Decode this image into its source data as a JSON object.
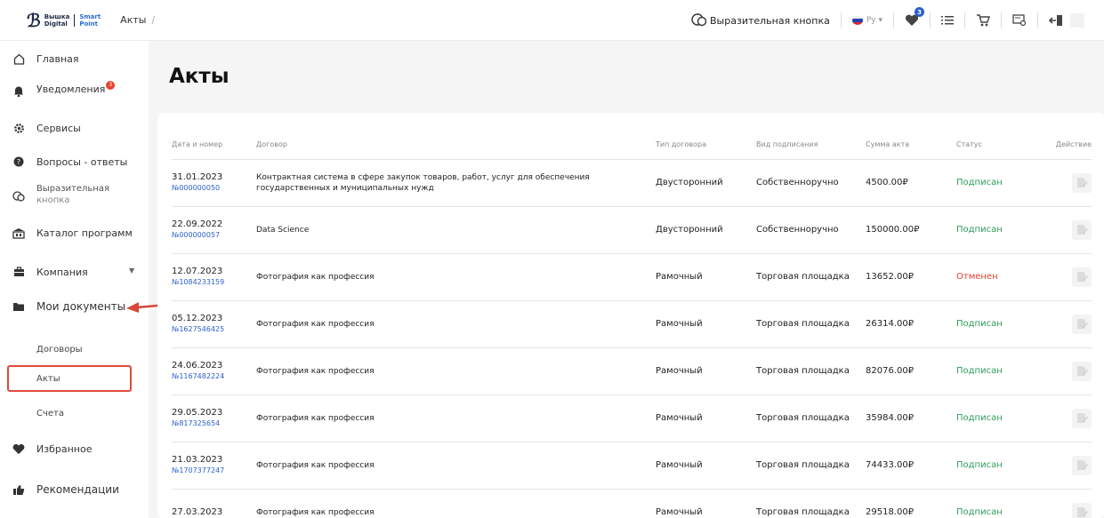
{
  "header": {
    "logo_line1": "Вышка",
    "logo_line2": "Digital",
    "logo_line3": "Smart",
    "logo_line4": "Point",
    "breadcrumb": "Акты",
    "breadcrumb_sep": "/",
    "expressive_button": "Выразительная кнопка",
    "lang": "Ру ▾",
    "favorites_count": "3"
  },
  "sidebar": {
    "items": [
      {
        "label": "Главная",
        "icon": "home-icon"
      },
      {
        "label": "Уведомления",
        "icon": "bell-icon",
        "badge": "3"
      },
      {
        "label": "Сервисы",
        "icon": "gear-icon"
      },
      {
        "label": "Вопросы - ответы",
        "icon": "help-icon"
      },
      {
        "label": "Выразительная",
        "label2": "кнопка",
        "icon": "expressive-icon"
      },
      {
        "label": "Каталог программ",
        "icon": "catalog-icon"
      },
      {
        "label": "Компания",
        "icon": "briefcase-icon"
      },
      {
        "label": "Мои документы",
        "icon": "folder-icon"
      },
      {
        "label": "Договоры"
      },
      {
        "label": "Акты"
      },
      {
        "label": "Счета"
      },
      {
        "label": "Избранное",
        "icon": "heart-icon"
      },
      {
        "label": "Рекомендации",
        "icon": "thumbs-up-icon"
      }
    ]
  },
  "main": {
    "title": "Акты",
    "columns": [
      "Дата и номер",
      "Договор",
      "Тип договора",
      "Вид подписания",
      "Сумма акта",
      "Статус",
      "Действие"
    ],
    "rows": [
      {
        "date": "31.01.2023",
        "num": "№000000050",
        "contract": "Контрактная система в сфере закупок товаров, работ, услуг для обеспечения государственных и муниципальных нужд",
        "type": "Двусторонний",
        "sign": "Собственноручно",
        "sum": "4500.00₽",
        "status": "Подписан"
      },
      {
        "date": "22.09.2022",
        "num": "№000000057",
        "contract": "Data Science",
        "type": "Двусторонний",
        "sign": "Собственноручно",
        "sum": "150000.00₽",
        "status": "Подписан"
      },
      {
        "date": "12.07.2023",
        "num": "№1084233159",
        "contract": "Фотография как профессия",
        "type": "Рамочный",
        "sign": "Торговая площадка",
        "sum": "13652.00₽",
        "status": "Отменен"
      },
      {
        "date": "05.12.2023",
        "num": "№1627546425",
        "contract": "Фотография как профессия",
        "type": "Рамочный",
        "sign": "Торговая площадка",
        "sum": "26314.00₽",
        "status": "Подписан"
      },
      {
        "date": "24.06.2023",
        "num": "№1167482224",
        "contract": "Фотография как профессия",
        "type": "Рамочный",
        "sign": "Торговая площадка",
        "sum": "82076.00₽",
        "status": "Подписан"
      },
      {
        "date": "29.05.2023",
        "num": "№817325654",
        "contract": "Фотография как профессия",
        "type": "Рамочный",
        "sign": "Торговая площадка",
        "sum": "35984.00₽",
        "status": "Подписан"
      },
      {
        "date": "21.03.2023",
        "num": "№1707377247",
        "contract": "Фотография как профессия",
        "type": "Рамочный",
        "sign": "Торговая площадка",
        "sum": "74433.00₽",
        "status": "Подписан"
      },
      {
        "date": "27.03.2023",
        "num": "",
        "contract": "Фотография как профессия",
        "type": "Рамочный",
        "sign": "Торговая площадка",
        "sum": "29518.00₽",
        "status": "Подписан"
      }
    ]
  },
  "colors": {
    "accent": "#2b5fc7",
    "signed": "#2e9e5a",
    "cancelled": "#e0402e",
    "highlight": "#e04a3c"
  }
}
